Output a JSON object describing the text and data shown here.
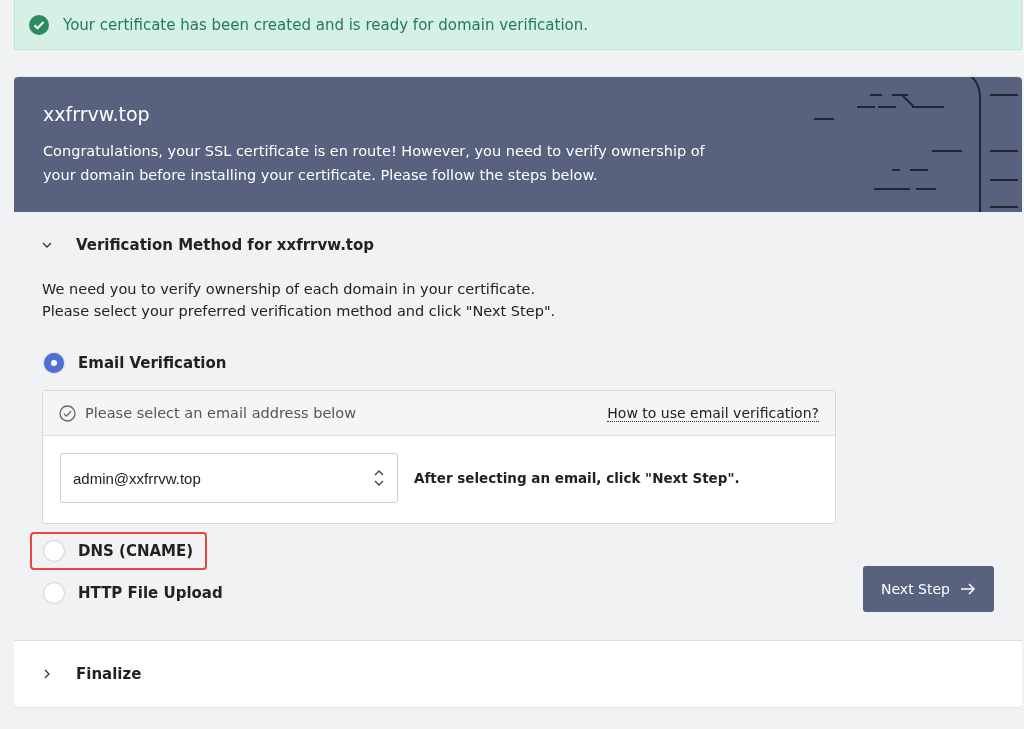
{
  "alert": {
    "text": "Your certificate has been created and is ready for domain verification."
  },
  "header": {
    "domain": "xxfrrvw.top",
    "message": "Congratulations, your SSL certificate is en route! However, you need to verify ownership of your domain before installing your certificate. Please follow the steps below."
  },
  "sections": [
    {
      "title": "Verification Method for xxfrrvw.top",
      "expanded": true,
      "intro": [
        "We need you to verify ownership of each domain in your certificate.",
        "Please select your preferred verification method and click \"Next Step\"."
      ],
      "options": [
        {
          "label": "Email Verification",
          "selected": true,
          "highlighted": false
        },
        {
          "label": "DNS (CNAME)",
          "selected": false,
          "highlighted": true
        },
        {
          "label": "HTTP File Upload",
          "selected": false,
          "highlighted": false
        }
      ],
      "email_panel": {
        "heading": "Please select an email address below",
        "help_link": "How to use email verification?",
        "email": "admin@xxfrrvw.top",
        "hint": "After selecting an email, click \"Next Step\"."
      },
      "button": "Next Step"
    },
    {
      "title": "Finalize",
      "expanded": false
    }
  ]
}
